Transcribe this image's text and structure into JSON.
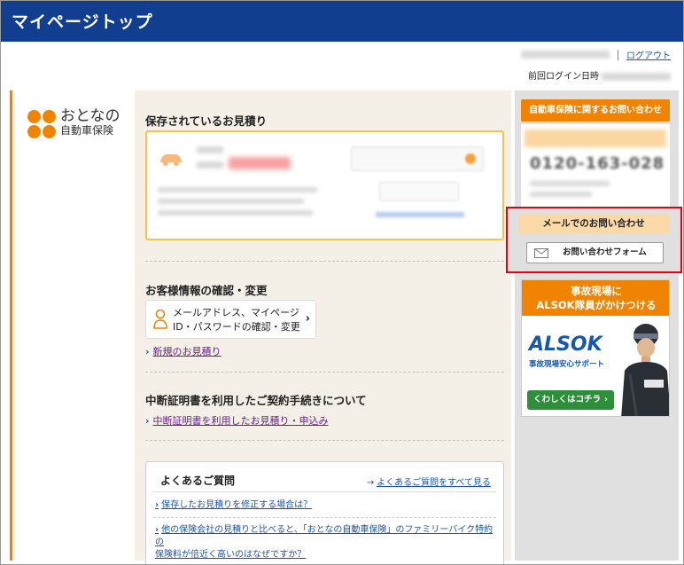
{
  "header": {
    "title": "マイページトップ"
  },
  "user": {
    "logout_label": "ログアウト",
    "last_login_label": "前回ログイン日時"
  },
  "brand": {
    "logo_line1": "おとなの",
    "logo_line2": "自動車保険"
  },
  "saved_quotes": {
    "title": "保存されているお見積り"
  },
  "customer_info": {
    "title": "お客様情報の確認・変更",
    "button_line1": "メールアドレス、マイページ",
    "button_line2": "ID・パスワードの確認・変更",
    "new_quote_link": "新規のお見積り"
  },
  "interruption": {
    "title": "中断証明書を利用したご契約手続きについて",
    "link": "中断証明書を利用したお見積り・申込み"
  },
  "faq": {
    "title": "よくあるご質問",
    "see_all": "よくあるご質問をすべて見る",
    "questions": [
      "保存したお見積りを修正する場合は？",
      "他の保険会社の見積りと比べると、「おとなの自動車保険」のファミリーバイク特約の",
      "保険料が倍近く高いのはなぜですか？"
    ]
  },
  "sidebar": {
    "contact_title": "自動車保険に関するお問い合わせ",
    "phone_number": "0120-163-028",
    "mail_title": "メールでのお問い合わせ",
    "mail_button": "お問い合わせフォーム",
    "alsok_line1": "事故現場に",
    "alsok_line2": "ALSOK隊員がかけつける",
    "alsok_logo": "ALSOK",
    "alsok_sub": "事故現場安心サポート",
    "alsok_button": "くわしくはコチラ"
  },
  "colors": {
    "header_bg": "#113e8e",
    "accent_orange": "#f08300",
    "link_blue": "#1a55b3",
    "highlight_red": "#e60012",
    "alsok_green": "#2e8f3b"
  }
}
